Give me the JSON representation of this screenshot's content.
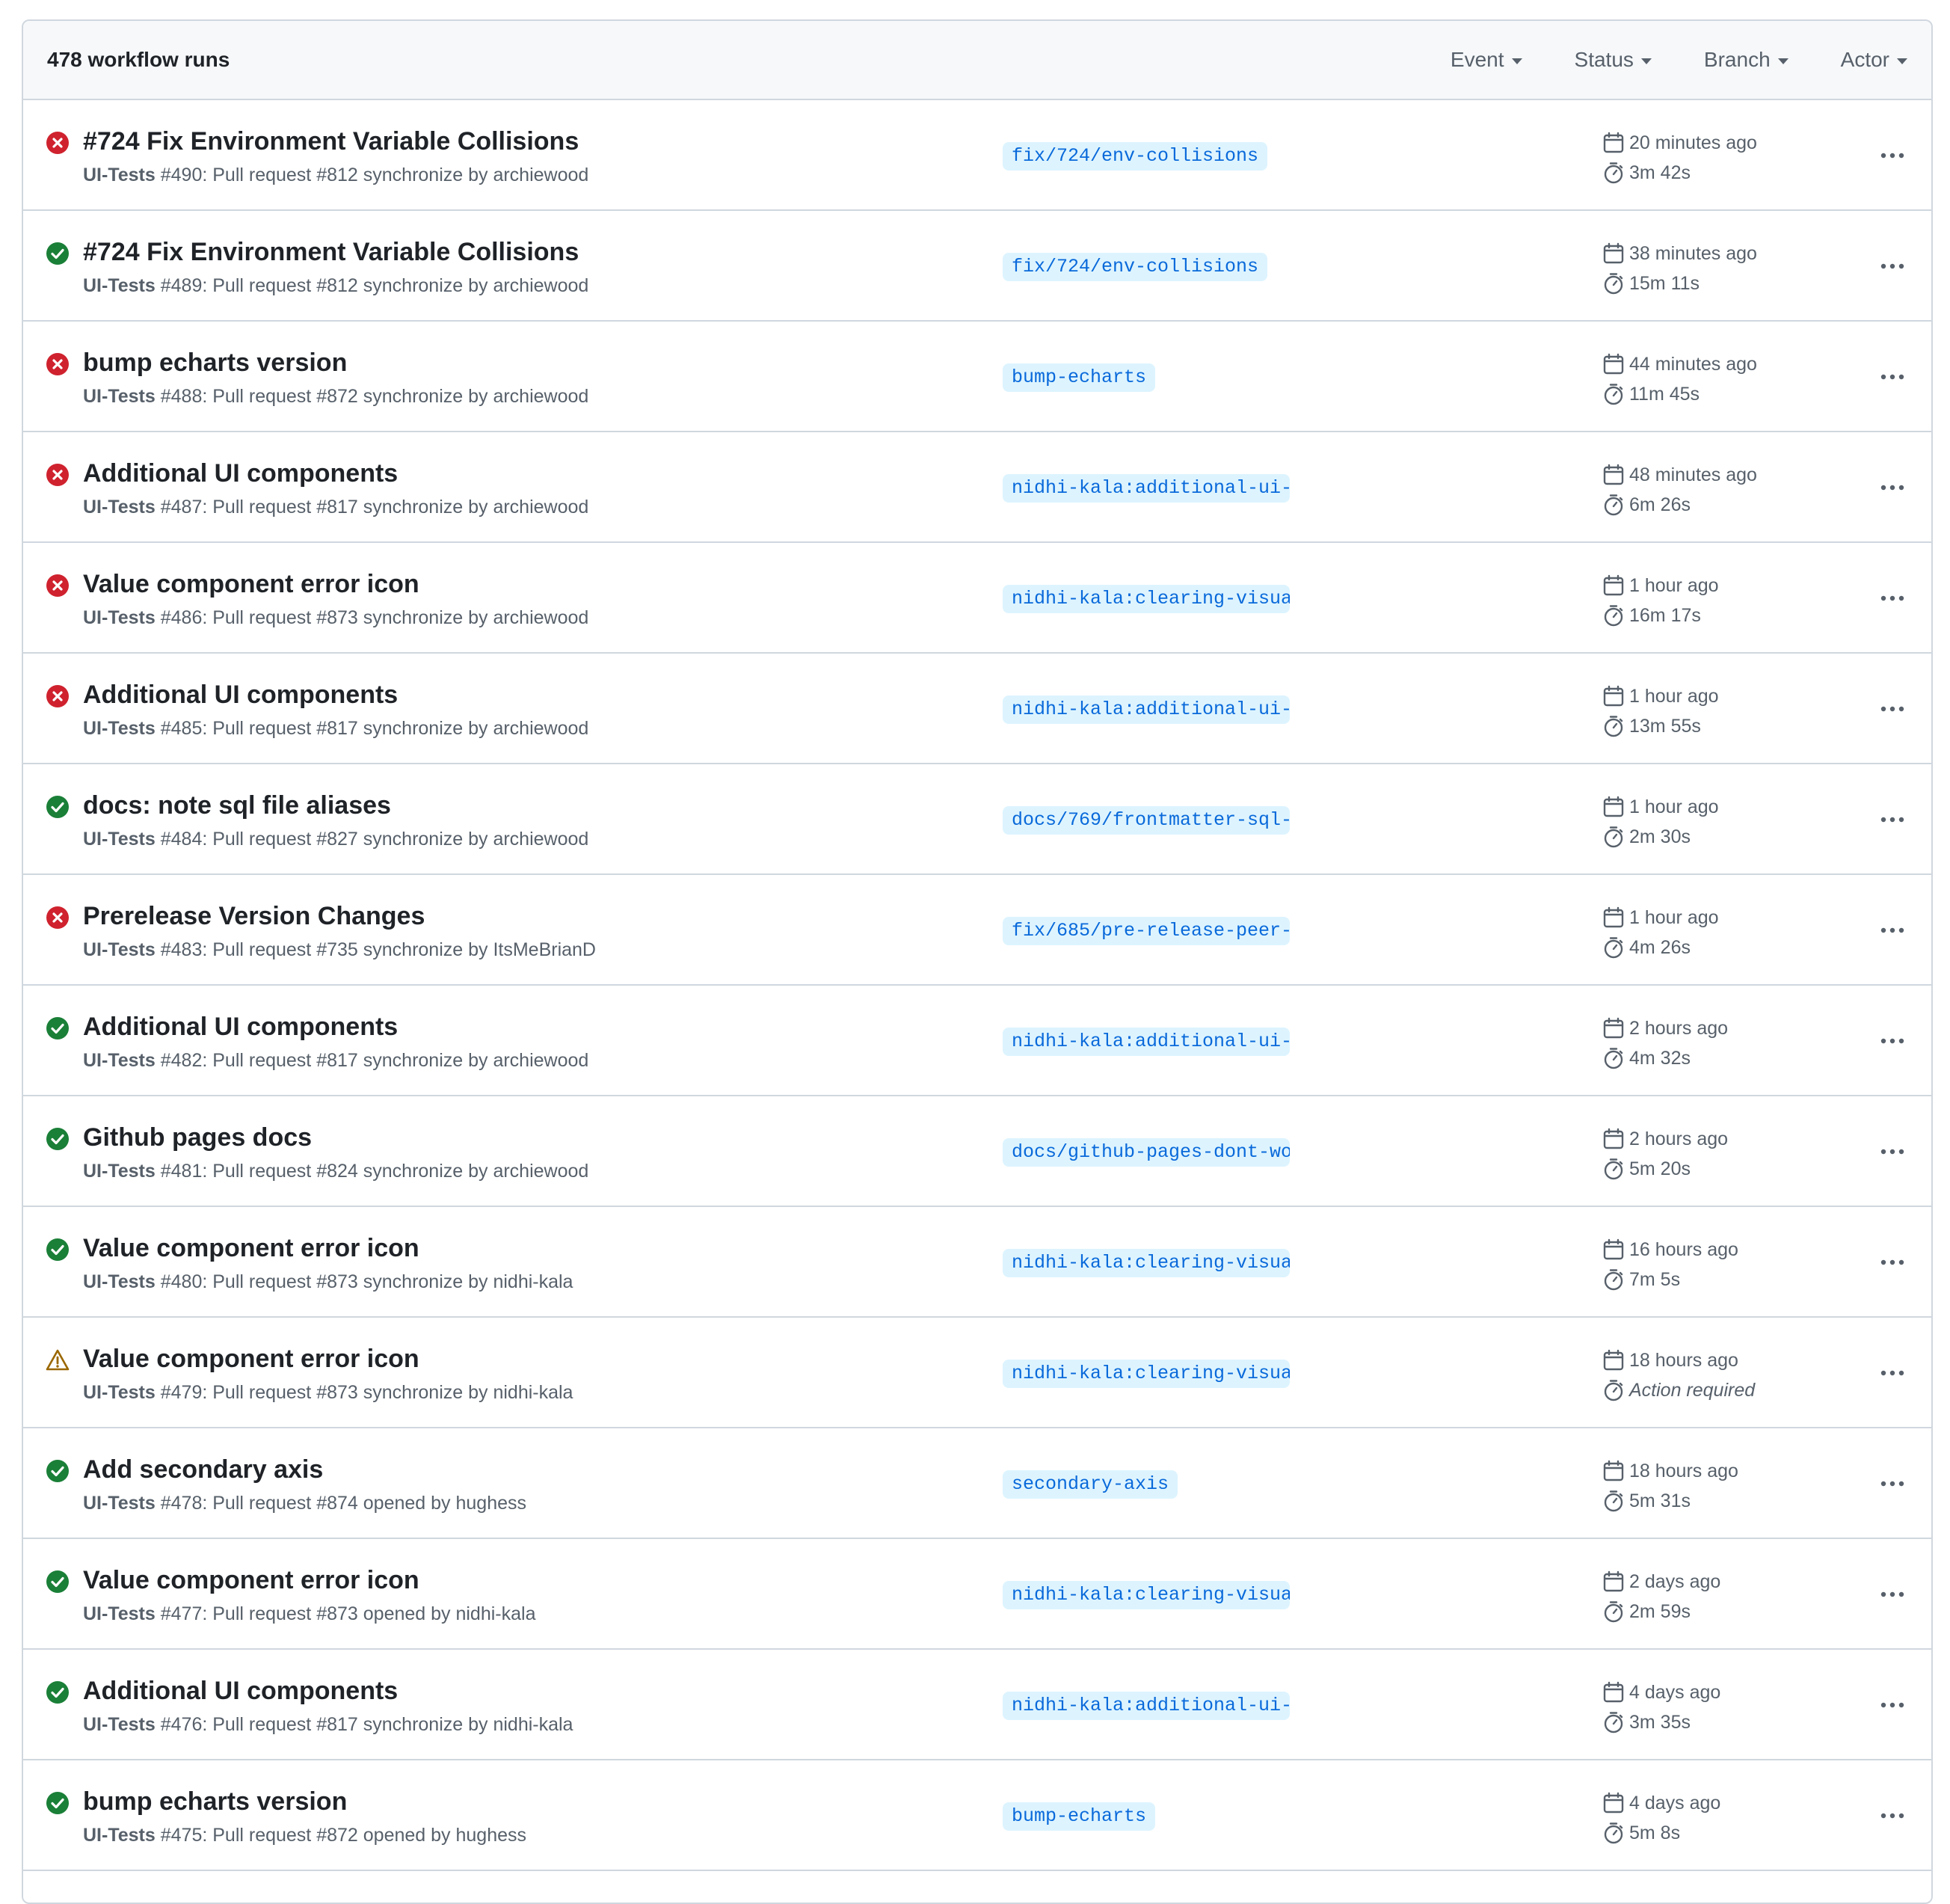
{
  "header": {
    "run_count": "478 workflow runs",
    "filters": [
      {
        "label": "Event"
      },
      {
        "label": "Status"
      },
      {
        "label": "Branch"
      },
      {
        "label": "Actor"
      }
    ]
  },
  "colors": {
    "success": "#1a7f37",
    "failure": "#cf222e",
    "warning": "#9a6700",
    "branch_bg": "#ddf4ff",
    "branch_fg": "#0969da"
  },
  "runs": [
    {
      "status": "failure",
      "title": "#724 Fix Environment Variable Collisions",
      "workflow": "UI-Tests",
      "meta": " #490: Pull request #812 synchronize by archiewood",
      "branch": "fix/724/env-collisions",
      "when": "20 minutes ago",
      "duration": "3m 42s"
    },
    {
      "status": "success",
      "title": "#724 Fix Environment Variable Collisions",
      "workflow": "UI-Tests",
      "meta": " #489: Pull request #812 synchronize by archiewood",
      "branch": "fix/724/env-collisions",
      "when": "38 minutes ago",
      "duration": "15m 11s"
    },
    {
      "status": "failure",
      "title": "bump echarts version",
      "workflow": "UI-Tests",
      "meta": " #488: Pull request #872 synchronize by archiewood",
      "branch": "bump-echarts",
      "when": "44 minutes ago",
      "duration": "11m 45s"
    },
    {
      "status": "failure",
      "title": "Additional UI components",
      "workflow": "UI-Tests",
      "meta": " #487: Pull request #817 synchronize by archiewood",
      "branch": "nidhi-kala:additional-ui-…",
      "when": "48 minutes ago",
      "duration": "6m 26s"
    },
    {
      "status": "failure",
      "title": "Value component error icon",
      "workflow": "UI-Tests",
      "meta": " #486: Pull request #873 synchronize by archiewood",
      "branch": "nidhi-kala:clearing-visua…",
      "when": "1 hour ago",
      "duration": "16m 17s"
    },
    {
      "status": "failure",
      "title": "Additional UI components",
      "workflow": "UI-Tests",
      "meta": " #485: Pull request #817 synchronize by archiewood",
      "branch": "nidhi-kala:additional-ui-…",
      "when": "1 hour ago",
      "duration": "13m 55s"
    },
    {
      "status": "success",
      "title": "docs: note sql file aliases",
      "workflow": "UI-Tests",
      "meta": " #484: Pull request #827 synchronize by archiewood",
      "branch": "docs/769/frontmatter-sql-…",
      "when": "1 hour ago",
      "duration": "2m 30s"
    },
    {
      "status": "failure",
      "title": "Prerelease Version Changes",
      "workflow": "UI-Tests",
      "meta": " #483: Pull request #735 synchronize by ItsMeBrianD",
      "branch": "fix/685/pre-release-peer-…",
      "when": "1 hour ago",
      "duration": "4m 26s"
    },
    {
      "status": "success",
      "title": "Additional UI components",
      "workflow": "UI-Tests",
      "meta": " #482: Pull request #817 synchronize by archiewood",
      "branch": "nidhi-kala:additional-ui-…",
      "when": "2 hours ago",
      "duration": "4m 32s"
    },
    {
      "status": "success",
      "title": "Github pages docs",
      "workflow": "UI-Tests",
      "meta": " #481: Pull request #824 synchronize by archiewood",
      "branch": "docs/github-pages-dont-wo…",
      "when": "2 hours ago",
      "duration": "5m 20s"
    },
    {
      "status": "success",
      "title": "Value component error icon",
      "workflow": "UI-Tests",
      "meta": " #480: Pull request #873 synchronize by nidhi-kala",
      "branch": "nidhi-kala:clearing-visua…",
      "when": "16 hours ago",
      "duration": "7m 5s"
    },
    {
      "status": "warning",
      "title": "Value component error icon",
      "workflow": "UI-Tests",
      "meta": " #479: Pull request #873 synchronize by nidhi-kala",
      "branch": "nidhi-kala:clearing-visua…",
      "when": "18 hours ago",
      "duration": "Action required"
    },
    {
      "status": "success",
      "title": "Add secondary axis",
      "workflow": "UI-Tests",
      "meta": " #478: Pull request #874 opened by hughess",
      "branch": "secondary-axis",
      "when": "18 hours ago",
      "duration": "5m 31s"
    },
    {
      "status": "success",
      "title": "Value component error icon",
      "workflow": "UI-Tests",
      "meta": " #477: Pull request #873 opened by nidhi-kala",
      "branch": "nidhi-kala:clearing-visua…",
      "when": "2 days ago",
      "duration": "2m 59s"
    },
    {
      "status": "success",
      "title": "Additional UI components",
      "workflow": "UI-Tests",
      "meta": " #476: Pull request #817 synchronize by nidhi-kala",
      "branch": "nidhi-kala:additional-ui-…",
      "when": "4 days ago",
      "duration": "3m 35s"
    },
    {
      "status": "success",
      "title": "bump echarts version",
      "workflow": "UI-Tests",
      "meta": " #475: Pull request #872 opened by hughess",
      "branch": "bump-echarts",
      "when": "4 days ago",
      "duration": "5m 8s"
    }
  ]
}
